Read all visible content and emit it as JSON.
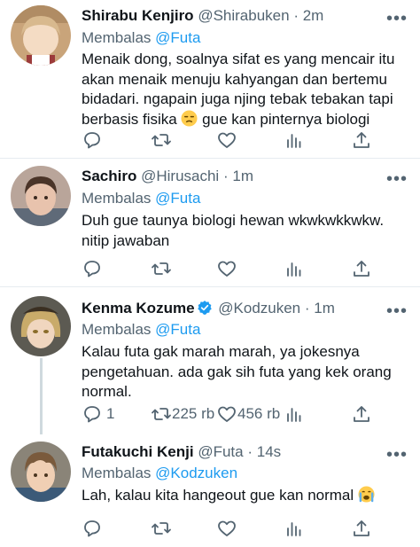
{
  "tweets": [
    {
      "name": "Shirabu Kenjiro",
      "handle": "@Shirabuken",
      "dot": "·",
      "time": "2m",
      "reply_label": "Membalas",
      "reply_to": "@Futa",
      "text_before_emoji": "Menaik dong, soalnya sifat es yang mencair itu akan menaik menuju kahyangan dan bertemu bidadari. ngapain juga njing tebak tebakan tapi berbasis fisika ",
      "emoji": "unamused-face-emoji",
      "text_after_emoji": " gue kan pinternya biologi",
      "avatar_colors": {
        "bg": "#c9a47a",
        "hair": "#d8b98e",
        "skin": "#f4dcc4"
      }
    },
    {
      "name": "Sachiro",
      "handle": "@Hirusachi",
      "dot": "·",
      "time": "1m",
      "reply_label": "Membalas",
      "reply_to": "@Futa",
      "text": "Duh gue taunya biologi hewan wkwkwkkwkw. nitip jawaban",
      "avatar_colors": {
        "bg": "#b9a59a",
        "hair": "#4a3428",
        "skin": "#e8c3ad"
      }
    },
    {
      "name": "Kenma Kozume",
      "handle": "@Kodzuken",
      "dot": "·",
      "time": "1m",
      "verified": true,
      "reply_label": "Membalas",
      "reply_to": "@Futa",
      "text": "Kalau futa gak marah marah, ya jokesnya pengetahuan. ada gak sih futa yang kek orang normal.",
      "replies": "1",
      "retweets": "225 rb",
      "likes": "456 rb",
      "avatar_colors": {
        "bg": "#5c5a52",
        "hair": "#c9ab6a",
        "skin": "#f0d6bf"
      }
    },
    {
      "name": "Futakuchi Kenji",
      "handle": "@Futa",
      "dot": "·",
      "time": "14s",
      "reply_label": "Membalas",
      "reply_to": "@Kodzuken",
      "text_before_emoji": "Lah, kalau kita hangeout gue kan normal ",
      "emoji": "crying-face-emoji",
      "avatar_colors": {
        "bg": "#8a8478",
        "hair": "#7a5a3c",
        "skin": "#f0cfb4"
      }
    }
  ],
  "more_label": "•••",
  "accent_color": "#1d9bf0",
  "verified_color": "#1d9bf0",
  "muted_color": "#536471"
}
